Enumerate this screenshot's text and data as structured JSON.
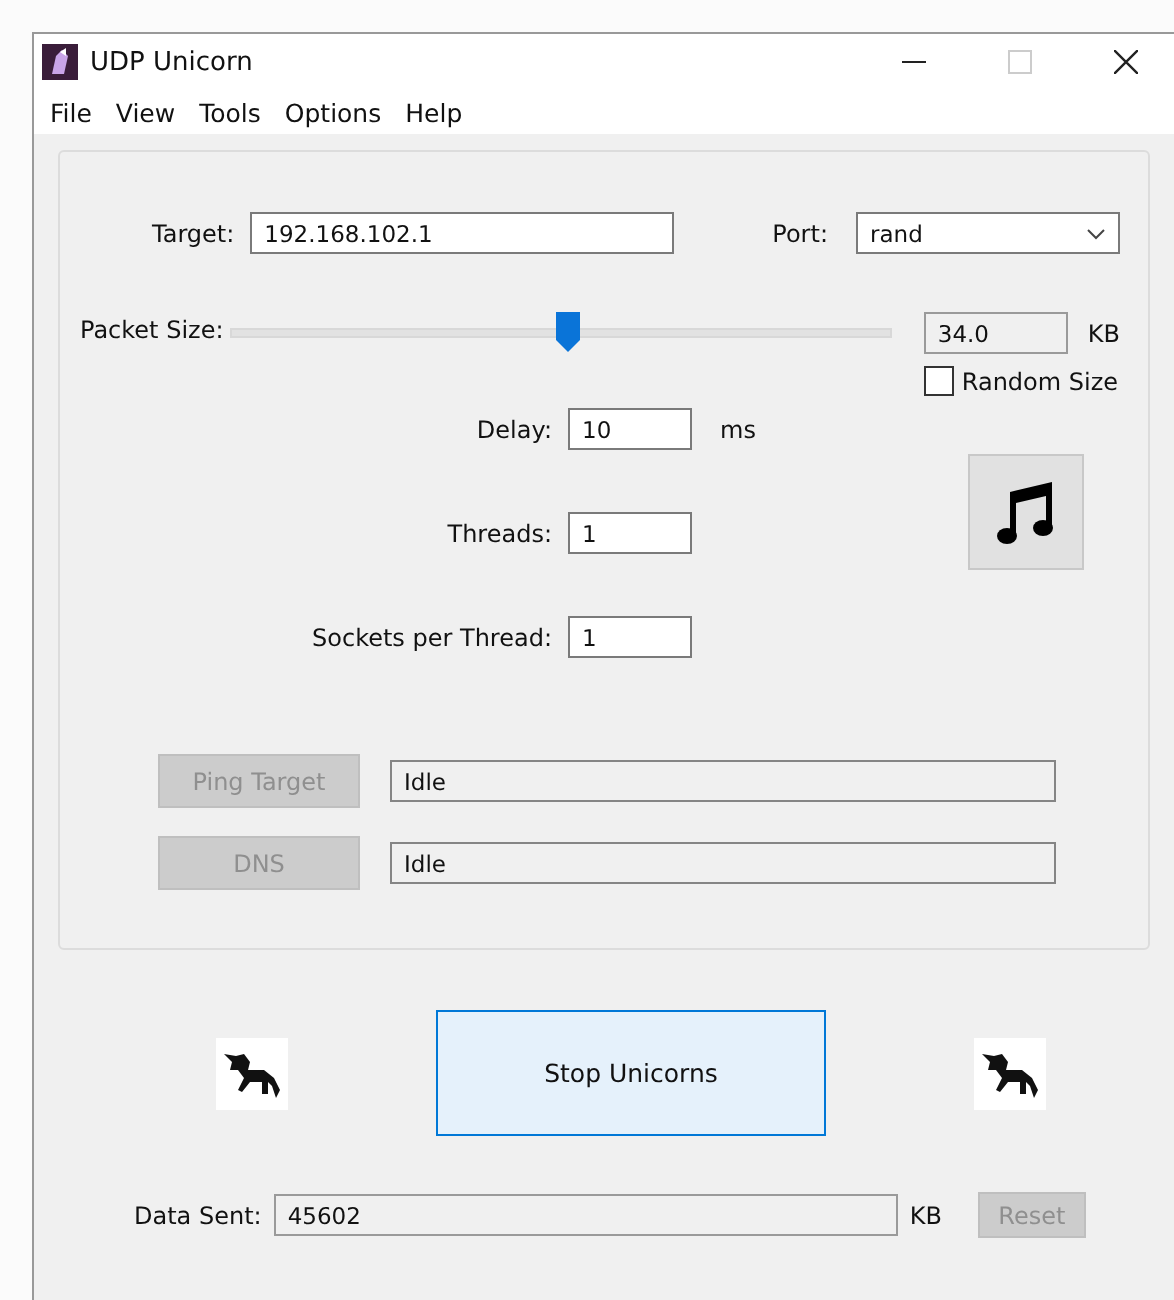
{
  "window": {
    "title": "UDP Unicorn"
  },
  "menu": [
    "File",
    "View",
    "Tools",
    "Options",
    "Help"
  ],
  "target": {
    "label": "Target:",
    "value": "192.168.102.1"
  },
  "port": {
    "label": "Port:",
    "value": "rand"
  },
  "packet_size": {
    "label": "Packet Size:",
    "level": 0.51,
    "value": "34.0",
    "unit": "KB",
    "random": {
      "label": "Random Size",
      "checked": false
    }
  },
  "fields": [
    {
      "label": "Delay:",
      "value": "10",
      "unit": "ms"
    },
    {
      "label": "Threads:",
      "value": "1"
    },
    {
      "label": "Sockets per Thread:",
      "value": "1"
    }
  ],
  "status_rows": [
    {
      "button": "Ping Target",
      "disabled": true,
      "status": "Idle"
    },
    {
      "button": "DNS",
      "disabled": true,
      "status": "Idle"
    }
  ],
  "main_button": "Stop Unicorns",
  "data_sent": {
    "label": "Data Sent:",
    "value": "45602",
    "unit": "KB",
    "reset": {
      "label": "Reset",
      "disabled": true
    }
  }
}
